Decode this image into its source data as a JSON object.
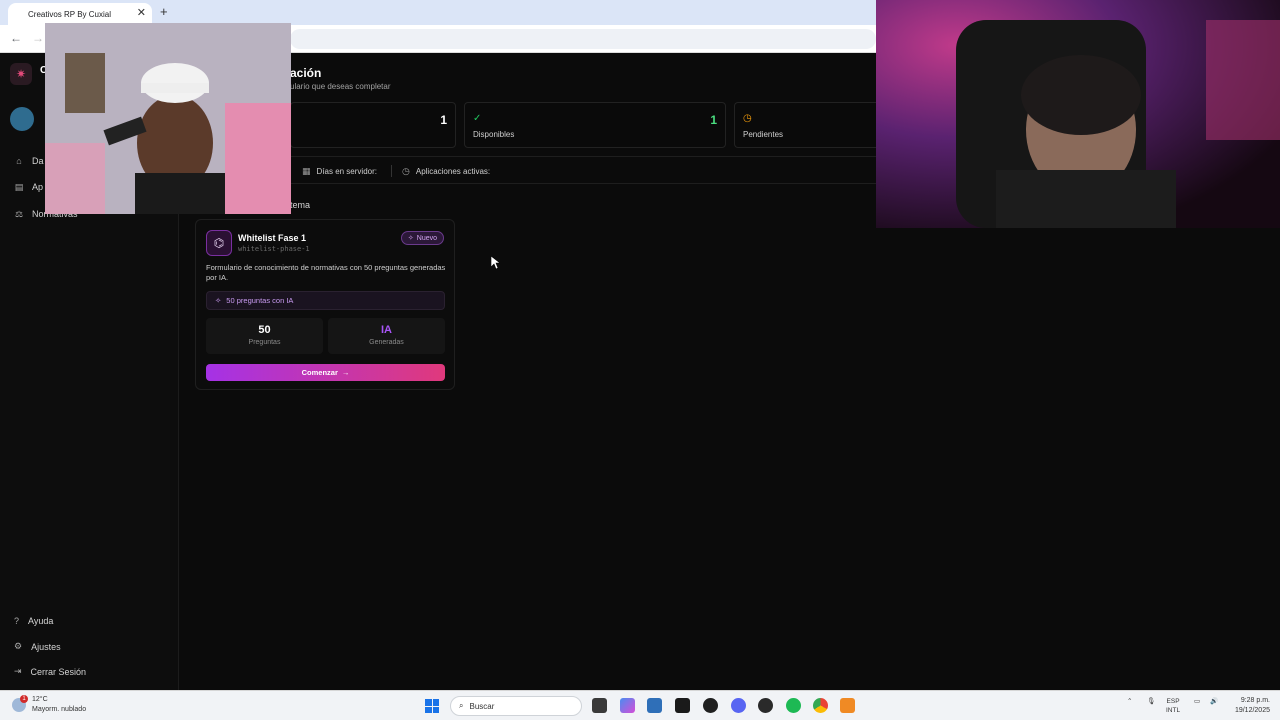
{
  "browser": {
    "tab_title": "Creativos RP By Cuxial",
    "tab_close": "✕",
    "new_tab": "+",
    "back": "←",
    "forward": "→"
  },
  "sidebar": {
    "logo_letter": "C",
    "items": [
      {
        "label": "Da",
        "icon": "home-icon",
        "glyph": "⌂"
      },
      {
        "label": "Ap",
        "icon": "document-icon",
        "glyph": "▤"
      },
      {
        "label": "Normativas",
        "icon": "gavel-icon",
        "glyph": "⚖"
      }
    ],
    "bottom": [
      {
        "label": "Ayuda",
        "icon": "help-icon",
        "glyph": "?"
      },
      {
        "label": "Ajustes",
        "icon": "gear-icon",
        "glyph": "⚙"
      },
      {
        "label": "Cerrar Sesión",
        "icon": "logout-icon",
        "glyph": "⇥"
      }
    ]
  },
  "header": {
    "title": "ación",
    "subtitle": "ulario que deseas completar"
  },
  "stats": [
    {
      "value": "1",
      "label": ""
    },
    {
      "value": "1",
      "label": "Disponibles",
      "icon": "check-circle-icon",
      "color": "#22c55e"
    },
    {
      "value": "",
      "label": "Pendientes",
      "icon": "clock-icon",
      "color": "#f59e0b"
    }
  ],
  "info": {
    "days_label": "Días en servidor:",
    "active_label": "Aplicaciones activas:"
  },
  "section": {
    "label": "tema"
  },
  "card": {
    "title": "Whitelist Fase 1",
    "slug": "whitelist-phase-1",
    "badge": "Nuevo",
    "description": "Formulario de conocimiento de normativas con 50 preguntas generadas por IA.",
    "ai_strip": "50 preguntas con IA",
    "stat1_value": "50",
    "stat1_label": "Preguntas",
    "stat2_value": "IA",
    "stat2_label": "Generadas",
    "cta": "Comenzar",
    "cta_arrow": "→"
  },
  "taskbar": {
    "temp": "12°C",
    "weather": "Mayorm. nublado",
    "notif_count": "1",
    "search": "Buscar",
    "lang1": "ESP",
    "lang2": "INTL",
    "time": "9:28 p.m.",
    "date": "19/12/2025"
  },
  "colors": {
    "accent_purple": "#a855f7",
    "accent_pink": "#e0397c",
    "success": "#22c55e",
    "warning": "#f59e0b"
  }
}
